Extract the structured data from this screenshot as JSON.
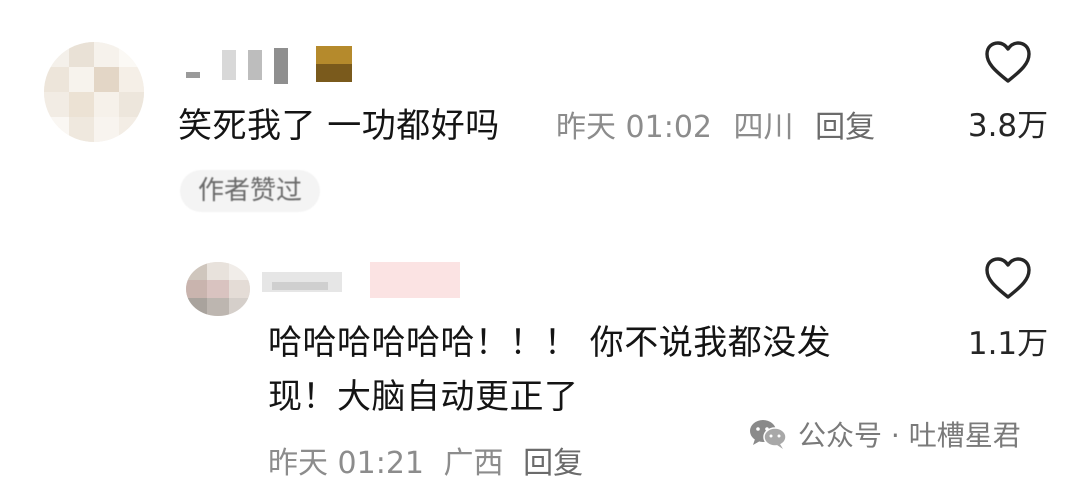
{
  "main_comment": {
    "text": "笑死我了 一功都好吗",
    "time": "昨天 01:02",
    "location": "四川",
    "reply_label": "回复",
    "likes": "3.8万",
    "badge": "作者赞过"
  },
  "reply_comment": {
    "text": "哈哈哈哈哈哈！！！ 你不说我都没发现！大脑自动更正了",
    "time": "昨天 01:21",
    "location": "广西",
    "reply_label": "回复",
    "likes": "1.1万"
  },
  "watermark": {
    "text": "公众号 · 吐槽星君"
  },
  "icons": {
    "like": "heart-outline-icon",
    "watermark": "wechat-icon"
  },
  "colors": {
    "text": "#141414",
    "meta": "#8c8c8c",
    "icon": "#262626",
    "badge_bg": "#f4f4f4"
  }
}
